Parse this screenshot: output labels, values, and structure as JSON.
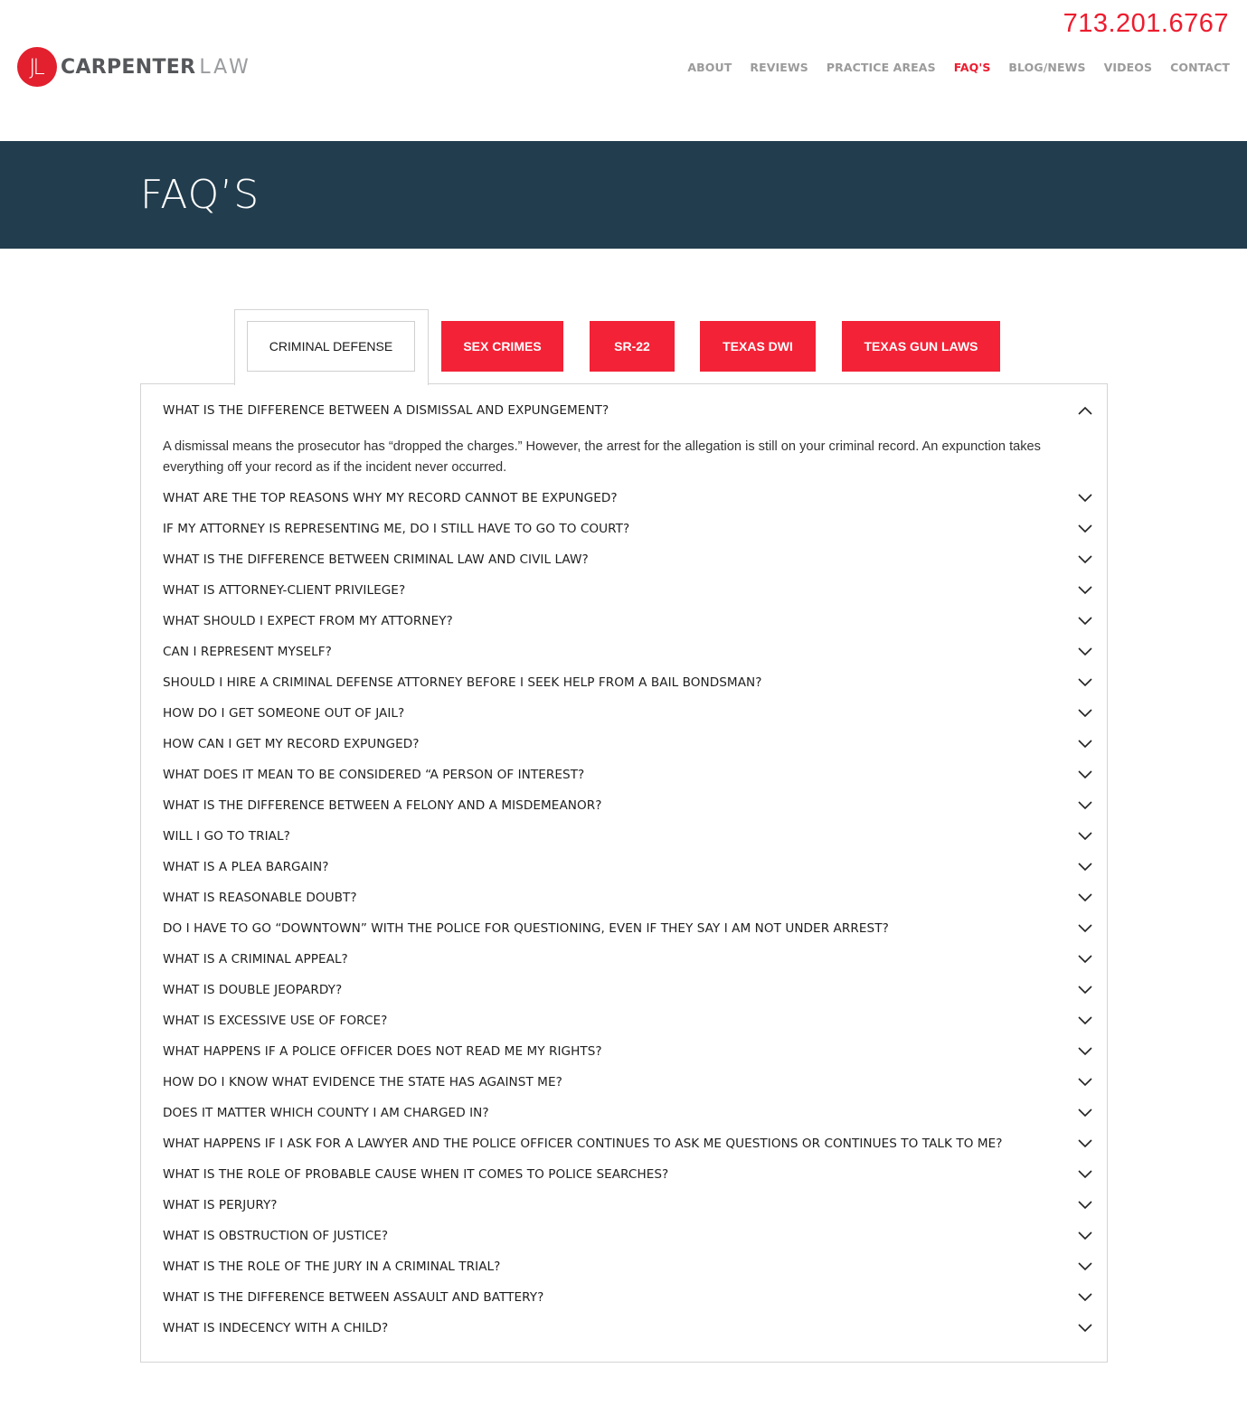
{
  "header": {
    "phone": "713.201.6767",
    "logo": {
      "monogram": "JL",
      "name_bold": "CARPENTER",
      "name_light": "LAW"
    },
    "nav": [
      {
        "label": "ABOUT",
        "active": false
      },
      {
        "label": "REVIEWS",
        "active": false
      },
      {
        "label": "PRACTICE AREAS",
        "active": false
      },
      {
        "label": "FAQ'S",
        "active": true
      },
      {
        "label": "BLOG/NEWS",
        "active": false
      },
      {
        "label": "VIDEOS",
        "active": false
      },
      {
        "label": "CONTACT",
        "active": false
      }
    ]
  },
  "banner": {
    "title": "FAQ’S"
  },
  "colors": {
    "brand_red": "#ed1c2e",
    "tab_red": "#f32236",
    "banner_navy": "#223d4d",
    "nav_gray": "#9b9b9b"
  },
  "tabs": [
    {
      "label": "CRIMINAL DEFENSE",
      "active": true
    },
    {
      "label": "SEX CRIMES",
      "active": false
    },
    {
      "label": "SR-22",
      "active": false
    },
    {
      "label": "TEXAS DWI",
      "active": false
    },
    {
      "label": "TEXAS GUN LAWS",
      "active": false
    }
  ],
  "faqs": [
    {
      "question": "WHAT IS THE DIFFERENCE BETWEEN A DISMISSAL AND EXPUNGEMENT?",
      "expanded": true,
      "answer": "A dismissal means the prosecutor has “dropped the charges.” However, the arrest for the allegation is still on your criminal record. An expunction takes everything off your record as if the incident never occurred."
    },
    {
      "question": "WHAT ARE THE TOP REASONS WHY MY RECORD CANNOT BE EXPUNGED?",
      "expanded": false
    },
    {
      "question": "IF MY ATTORNEY IS REPRESENTING ME, DO I STILL HAVE TO GO TO COURT?",
      "expanded": false
    },
    {
      "question": "WHAT IS THE DIFFERENCE BETWEEN CRIMINAL LAW AND CIVIL LAW?",
      "expanded": false
    },
    {
      "question": "WHAT IS ATTORNEY-CLIENT PRIVILEGE?",
      "expanded": false
    },
    {
      "question": "WHAT SHOULD I EXPECT FROM MY ATTORNEY?",
      "expanded": false
    },
    {
      "question": "CAN I REPRESENT MYSELF?",
      "expanded": false
    },
    {
      "question": "SHOULD I HIRE A CRIMINAL DEFENSE ATTORNEY BEFORE I SEEK HELP FROM A BAIL BONDSMAN?",
      "expanded": false
    },
    {
      "question": "HOW DO I GET SOMEONE OUT OF JAIL?",
      "expanded": false
    },
    {
      "question": "HOW CAN I GET MY RECORD EXPUNGED?",
      "expanded": false
    },
    {
      "question": "WHAT DOES IT MEAN TO BE CONSIDERED “A PERSON OF INTEREST?",
      "expanded": false
    },
    {
      "question": "WHAT IS THE DIFFERENCE BETWEEN A FELONY AND A MISDEMEANOR?",
      "expanded": false
    },
    {
      "question": "WILL I GO TO TRIAL?",
      "expanded": false
    },
    {
      "question": "WHAT IS A PLEA BARGAIN?",
      "expanded": false
    },
    {
      "question": "WHAT IS REASONABLE DOUBT?",
      "expanded": false
    },
    {
      "question": "DO I HAVE TO GO “DOWNTOWN” WITH THE POLICE FOR QUESTIONING, EVEN IF THEY SAY I AM NOT UNDER ARREST?",
      "expanded": false
    },
    {
      "question": "WHAT IS A CRIMINAL APPEAL?",
      "expanded": false
    },
    {
      "question": "WHAT IS DOUBLE JEOPARDY?",
      "expanded": false
    },
    {
      "question": "WHAT IS EXCESSIVE USE OF FORCE?",
      "expanded": false
    },
    {
      "question": "WHAT HAPPENS IF A POLICE OFFICER DOES NOT READ ME MY RIGHTS?",
      "expanded": false
    },
    {
      "question": "HOW DO I KNOW WHAT EVIDENCE THE STATE HAS AGAINST ME?",
      "expanded": false
    },
    {
      "question": "DOES IT MATTER WHICH COUNTY I AM CHARGED IN?",
      "expanded": false
    },
    {
      "question": "WHAT HAPPENS IF I ASK FOR A LAWYER AND THE POLICE OFFICER CONTINUES TO ASK ME QUESTIONS OR CONTINUES TO TALK TO ME?",
      "expanded": false
    },
    {
      "question": "WHAT IS THE ROLE OF PROBABLE CAUSE WHEN IT COMES TO POLICE SEARCHES?",
      "expanded": false
    },
    {
      "question": "WHAT IS PERJURY?",
      "expanded": false
    },
    {
      "question": "WHAT IS OBSTRUCTION OF JUSTICE?",
      "expanded": false
    },
    {
      "question": "WHAT IS THE ROLE OF THE JURY IN A CRIMINAL TRIAL?",
      "expanded": false
    },
    {
      "question": "WHAT IS THE DIFFERENCE BETWEEN ASSAULT AND BATTERY?",
      "expanded": false
    },
    {
      "question": "WHAT IS INDECENCY WITH A CHILD?",
      "expanded": false
    }
  ]
}
